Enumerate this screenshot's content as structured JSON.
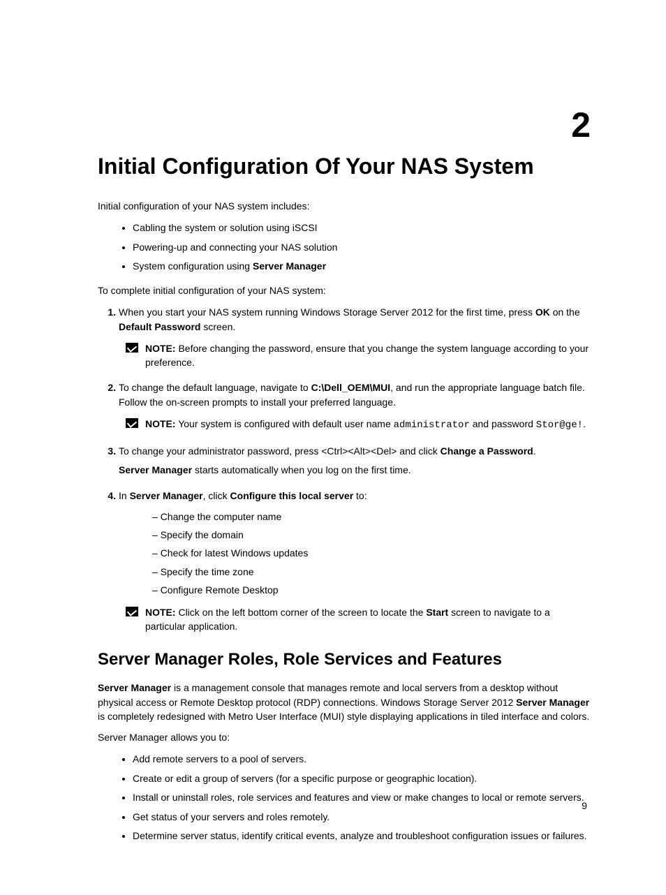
{
  "chapter_number": "2",
  "title": "Initial Configuration Of Your NAS System",
  "intro": "Initial configuration of your NAS system includes:",
  "intro_bullets": [
    {
      "pre": "Cabling the system or solution using iSCSI"
    },
    {
      "pre": "Powering-up and connecting your NAS solution"
    },
    {
      "pre": "System configuration using ",
      "bold": "Server Manager"
    }
  ],
  "lead2": "To complete initial configuration of your NAS system:",
  "steps": {
    "s1": {
      "t1": "When you start your NAS system running Windows Storage Server 2012 for the first time, press ",
      "b1": "OK",
      "t2": " on the ",
      "b2": "Default Password",
      "t3": " screen.",
      "note_label": "NOTE:",
      "note_text": " Before changing the password, ensure that you change the system language according to your preference."
    },
    "s2": {
      "t1": "To change the default language, navigate to ",
      "b1": "C:\\Dell_OEM\\MUI",
      "t2": ", and run the appropriate language batch file. Follow the on-screen prompts to install your preferred language.",
      "note_label": "NOTE:",
      "note_t1": " Your system is configured with default user name ",
      "note_m1": "administrator",
      "note_t2": " and password ",
      "note_m2": "Stor@ge!",
      "note_t3": "."
    },
    "s3": {
      "t1": "To change your administrator password, press <Ctrl><Alt><Del> and click ",
      "b1": "Change a Password",
      "t2": ".",
      "p2_b1": "Server Manager",
      "p2_t1": " starts automatically when you log on the first time."
    },
    "s4": {
      "t1": "In ",
      "b1": "Server Manager",
      "t2": ", click ",
      "b2": "Configure this local server",
      "t3": " to:",
      "dashes": [
        "Change the computer name",
        "Specify the domain",
        "Check for latest Windows updates",
        "Specify the time zone",
        "Configure Remote Desktop"
      ],
      "note_label": "NOTE:",
      "note_t1": " Click on the left bottom corner of the screen to locate the ",
      "note_b1": "Start",
      "note_t2": " screen to navigate to a particular application."
    }
  },
  "section2_title": "Server Manager Roles, Role Services and Features",
  "sm_para": {
    "b1": "Server Manager",
    "t1": " is a management console that manages remote and local servers from a desktop without physical access or Remote Desktop protocol (RDP) connections. Windows Storage Server 2012 ",
    "b2": "Server Manager",
    "t2": " is completely redesigned with Metro User Interface (MUI) style displaying applications in tiled interface and colors."
  },
  "sm_lead": "Server Manager allows you to:",
  "sm_bullets": [
    "Add remote servers to a pool of servers.",
    "Create or edit a group of servers (for a specific purpose or geographic location).",
    "Install or uninstall roles, role services and features and view or make changes to local or remote servers.",
    "Get status of your servers and roles remotely.",
    "Determine server status, identify critical events, analyze and troubleshoot configuration issues or failures."
  ],
  "page_number": "9"
}
